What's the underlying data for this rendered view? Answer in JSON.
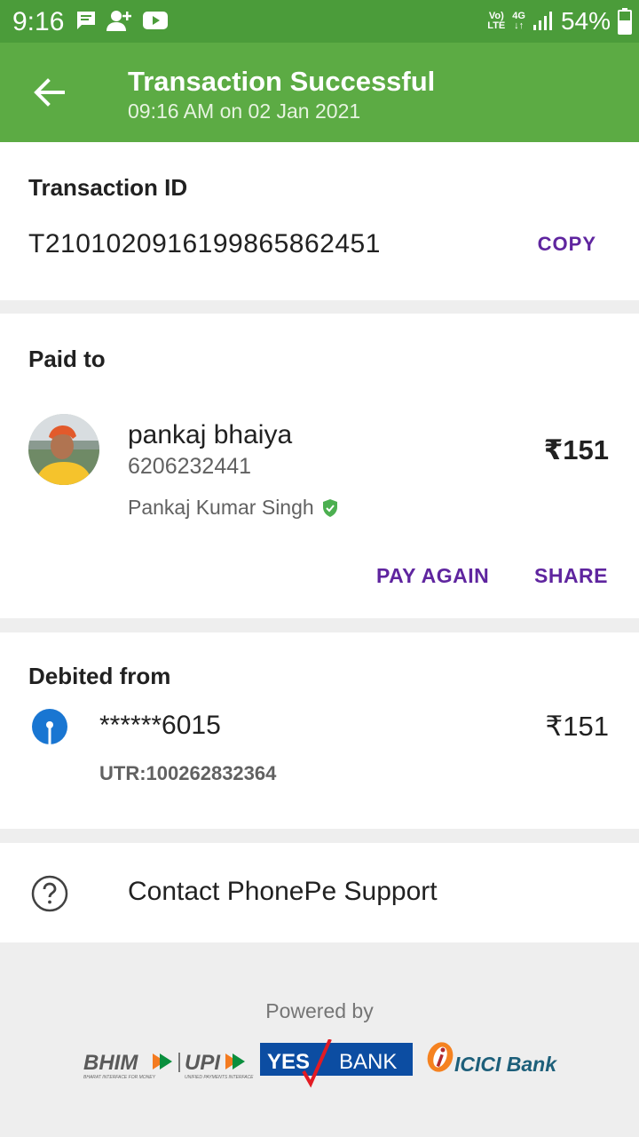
{
  "status_bar": {
    "time": "9:16",
    "network_top": "Vo)",
    "network_bottom": "LTE",
    "data_top": "4G",
    "data_bottom": "↓↑",
    "battery": "54%"
  },
  "header": {
    "title": "Transaction Successful",
    "subtitle": "09:16 AM on 02 Jan 2021"
  },
  "transaction": {
    "label": "Transaction ID",
    "id": "T2101020916199865862451",
    "copy_label": "COPY"
  },
  "paid_to": {
    "label": "Paid to",
    "name": "pankaj bhaiya",
    "phone": "6206232441",
    "verified_name": "Pankaj Kumar Singh",
    "amount": "₹151",
    "pay_again_label": "PAY AGAIN",
    "share_label": "SHARE"
  },
  "debited_from": {
    "label": "Debited from",
    "account": "******6015",
    "amount": "₹151",
    "utr": "UTR:100262832364"
  },
  "support": {
    "label": "Contact PhonePe Support"
  },
  "footer": {
    "powered_by": "Powered by",
    "logo_bhim": "BHIM",
    "logo_upi": "UPI",
    "logo_bhim_tag": "BHARAT INTERFACE FOR MONEY",
    "logo_upi_tag": "UNIFIED PAYMENTS INTERFACE",
    "logo_yes": "YES",
    "logo_bank": "BANK",
    "logo_icici": "ICICI Bank"
  },
  "colors": {
    "status_bar": "#4b9c3a",
    "app_bar": "#5cab44",
    "accent_purple": "#5f259f",
    "verified_green": "#4caf50",
    "sbi_blue": "#1976d2"
  }
}
